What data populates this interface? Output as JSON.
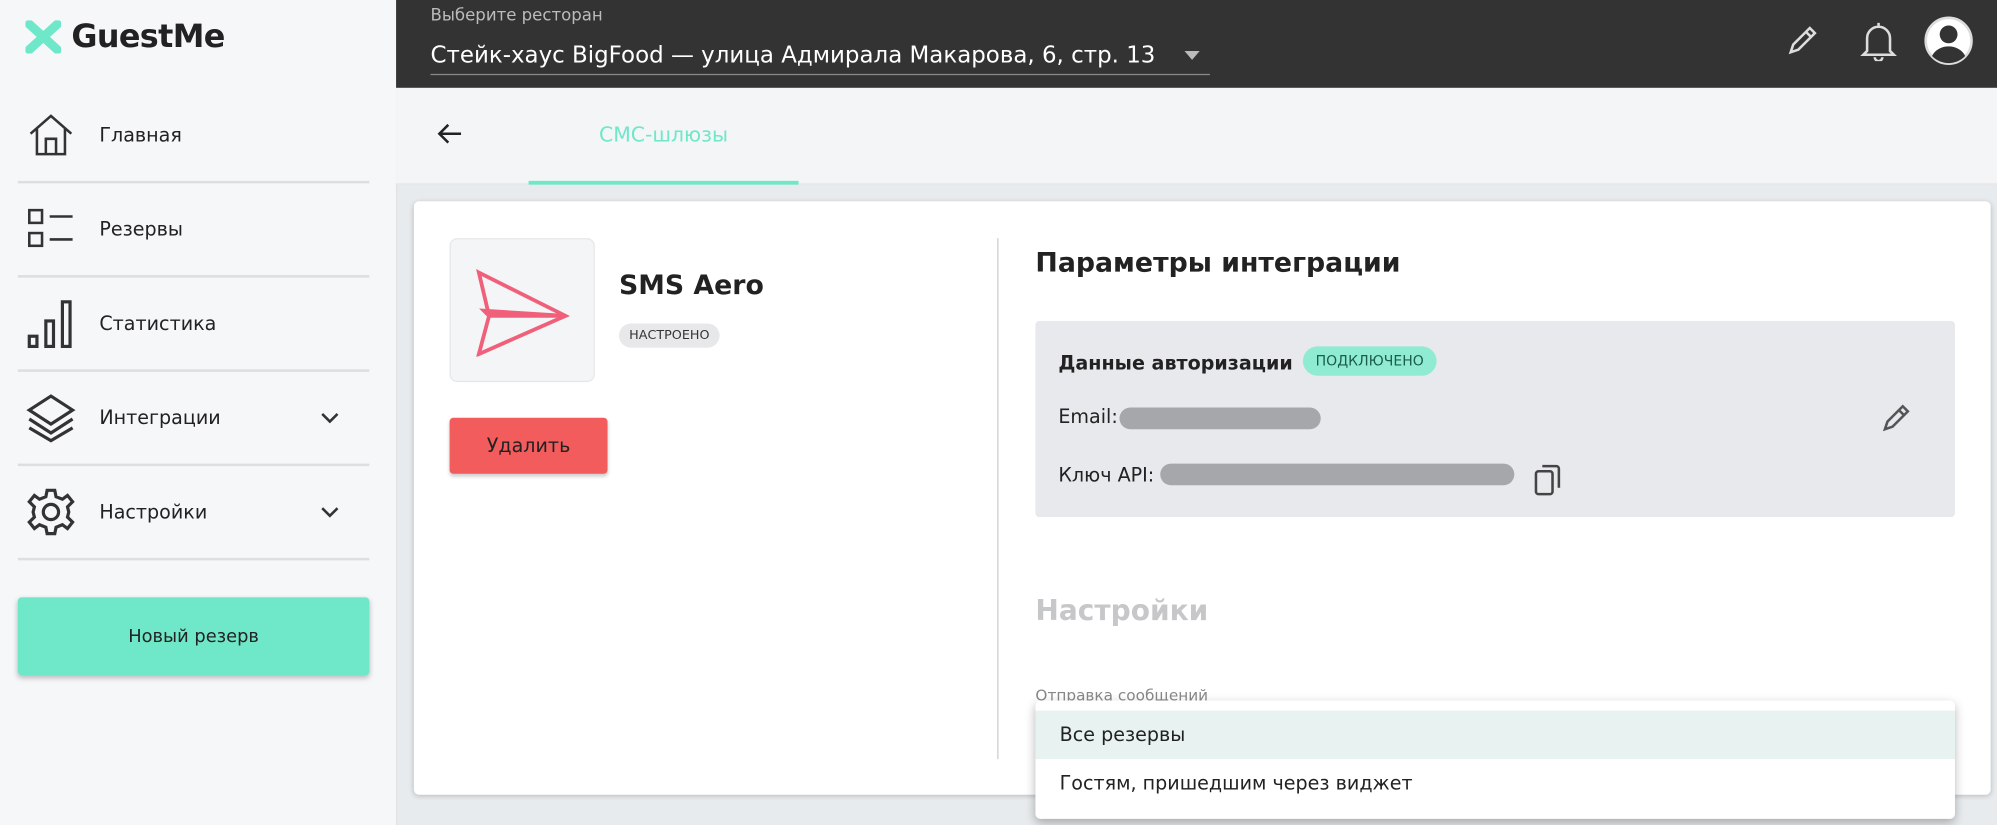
{
  "app": {
    "name": "GuestMe",
    "brand_color": "#6fe7c9"
  },
  "sidebar": {
    "items": [
      {
        "label": "Главная",
        "icon": "home-icon"
      },
      {
        "label": "Резервы",
        "icon": "list-icon"
      },
      {
        "label": "Статистика",
        "icon": "bar-chart-icon"
      },
      {
        "label": "Интеграции",
        "icon": "layers-icon",
        "expandable": true
      },
      {
        "label": "Настройки",
        "icon": "gear-icon",
        "expandable": true
      }
    ],
    "new_reservation": "Новый резерв"
  },
  "topbar": {
    "restaurant_label": "Выберите ресторан",
    "restaurant_value": "Стейк-хаус BigFood — улица Адмирала Макарова, 6, стр. 13"
  },
  "tabs": {
    "active": "СМС-шлюзы"
  },
  "provider": {
    "name": "SMS Aero",
    "status": "НАСТРОЕНО",
    "delete": "Удалить"
  },
  "params": {
    "title": "Параметры интеграции",
    "auth_title": "Данные авторизации",
    "auth_status": "ПОДКЛЮЧЕНО",
    "email_label": "Email:",
    "api_key_label": "Ключ API:"
  },
  "settings": {
    "title": "Настройки",
    "send_label": "Отправка сообщений",
    "options": [
      "Все резервы",
      "Гостям, пришедшим через виджет"
    ],
    "selected": "Все резервы"
  }
}
